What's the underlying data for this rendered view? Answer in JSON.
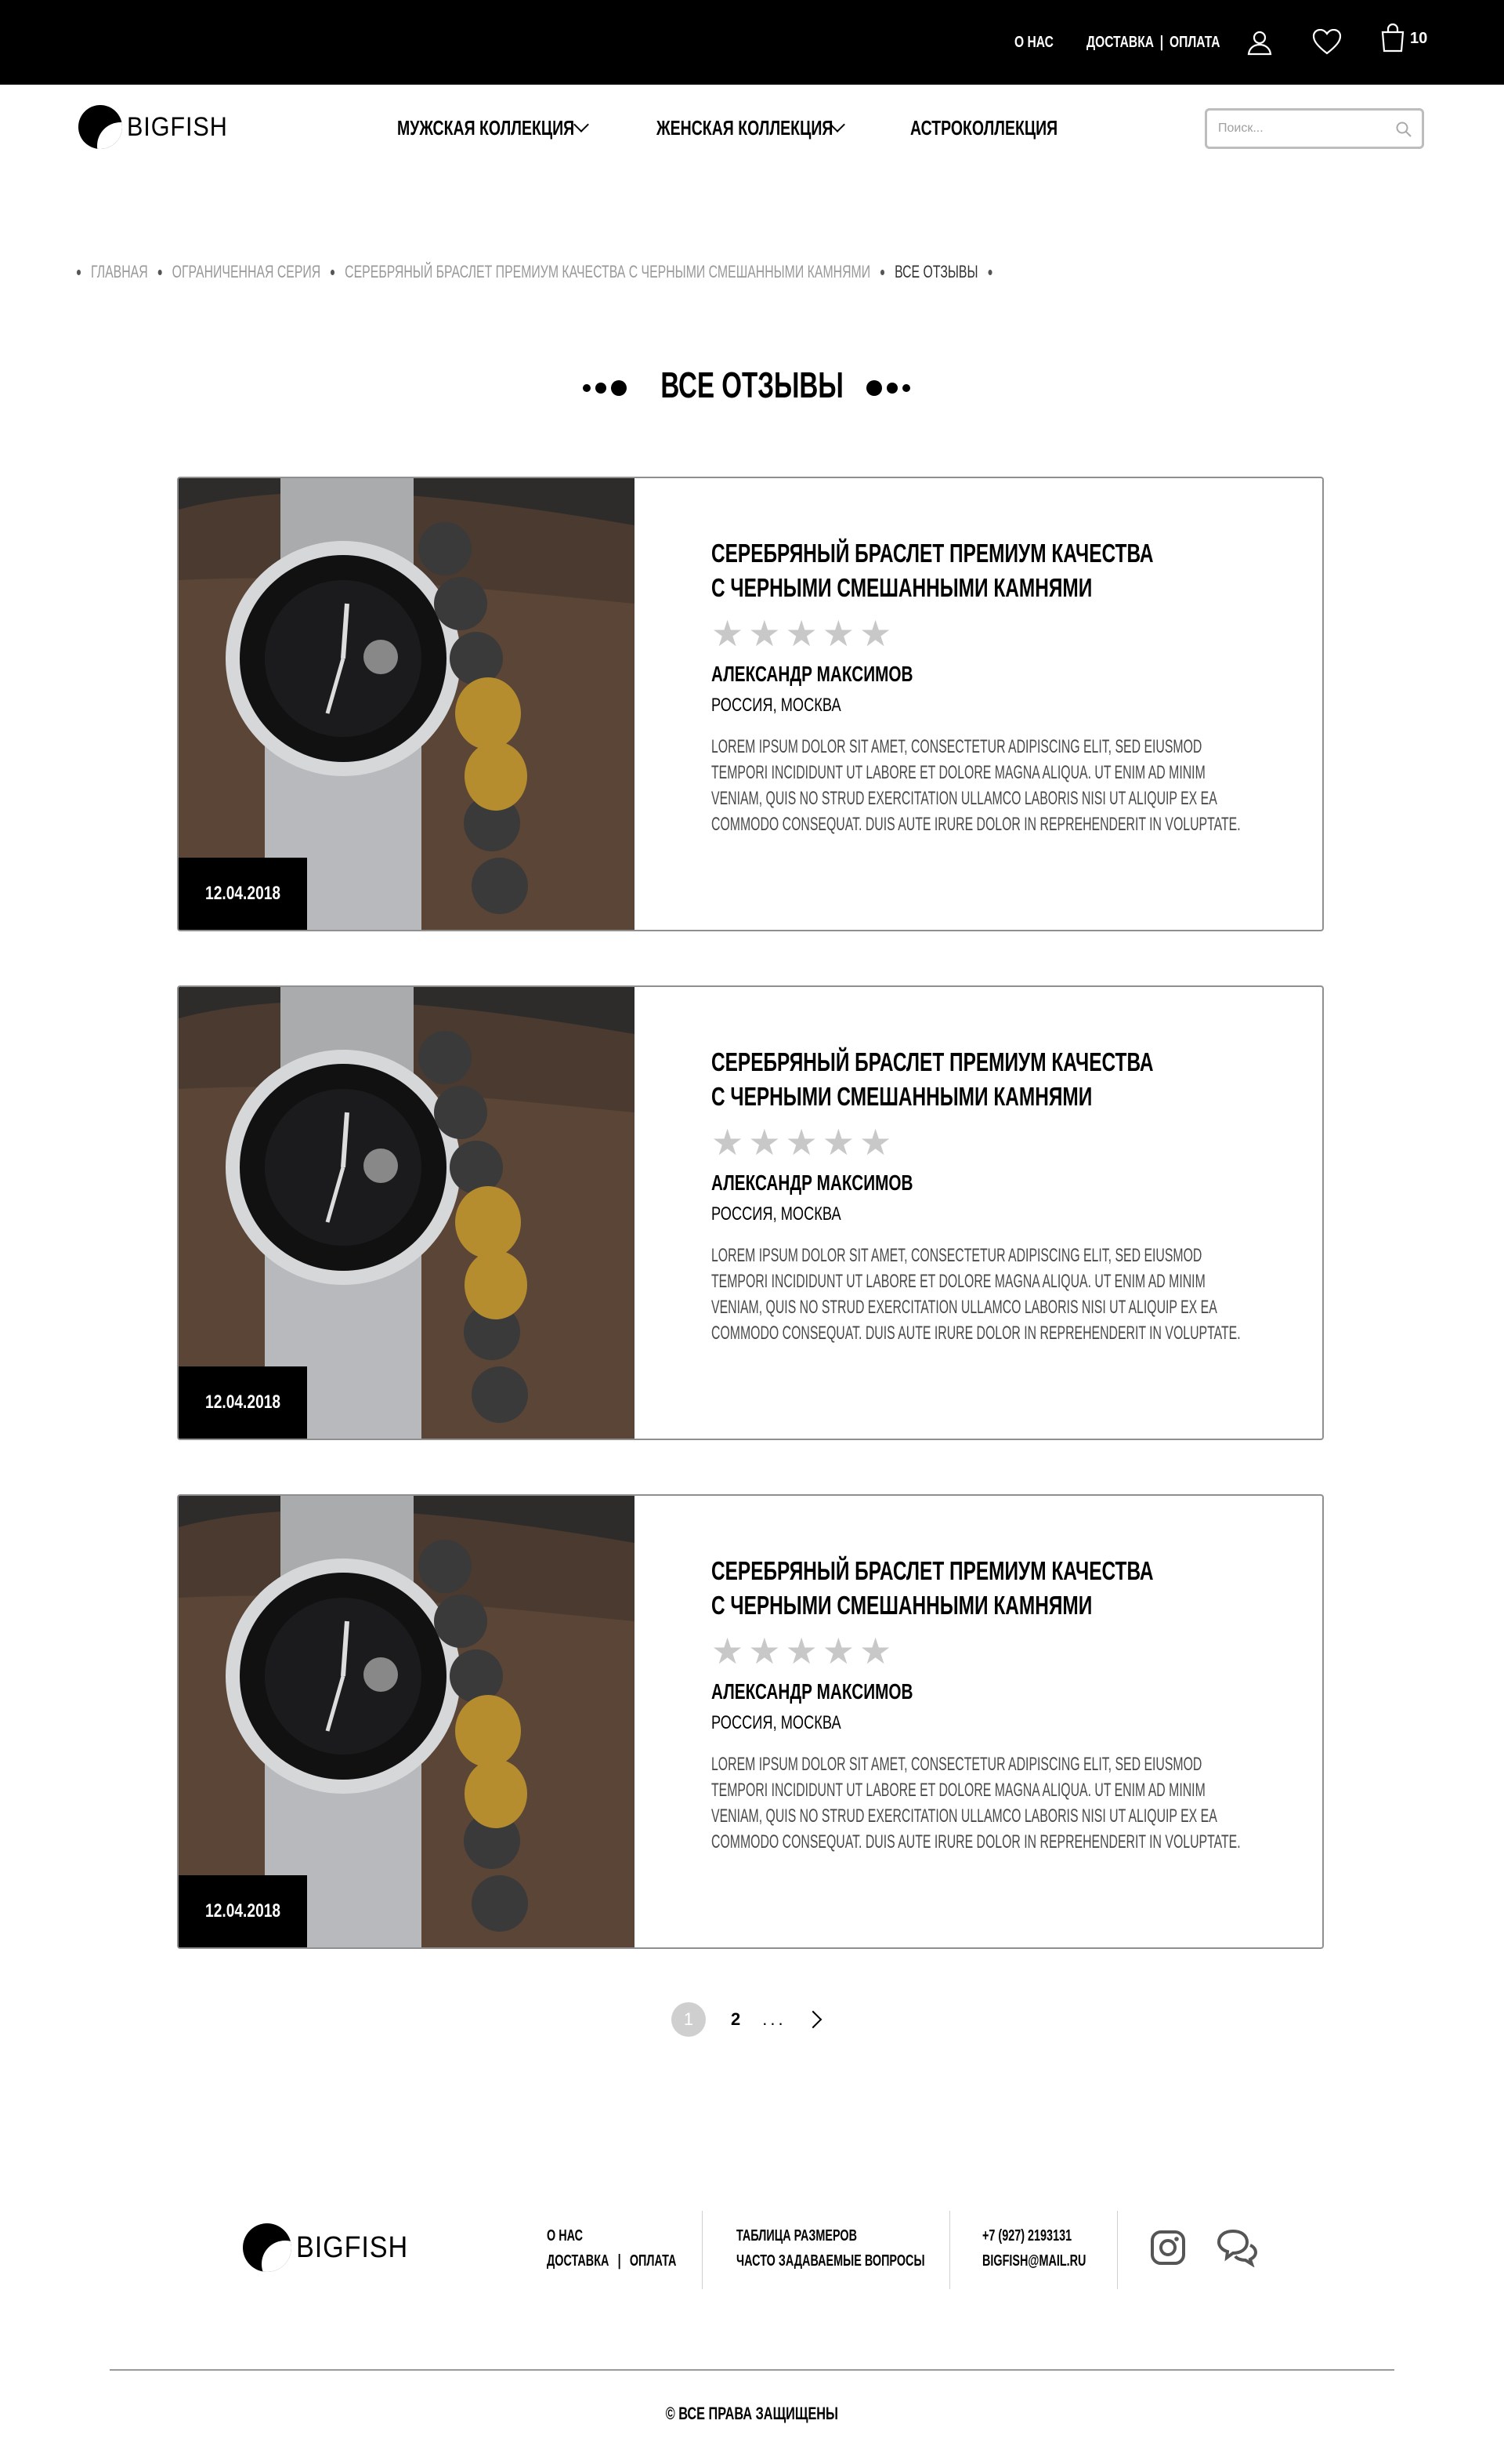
{
  "topbar": {
    "about": "О НАС",
    "delivery": "ДОСТАВКА",
    "payment": "ОПЛАТА",
    "separator": "|",
    "cart_count": "10"
  },
  "header": {
    "logo_text": "BIGFISH",
    "nav": [
      {
        "label": "МУЖСКАЯ КОЛЛЕКЦИЯ"
      },
      {
        "label": "ЖЕНСКАЯ КОЛЛЕКЦИЯ"
      },
      {
        "label": "АСТРОКОЛЛЕКЦИЯ"
      }
    ],
    "search_placeholder": "Поиск..."
  },
  "breadcrumb": [
    "ГЛАВНАЯ",
    "ОГРАНИЧЕННАЯ СЕРИЯ",
    "СЕРЕБРЯНЫЙ БРАСЛЕТ ПРЕМИУМ КАЧЕСТВА С ЧЕРНЫМИ СМЕШАННЫМИ КАМНЯМИ",
    "ВСЕ ОТЗЫВЫ"
  ],
  "page_title": "ВСЕ ОТЗЫВЫ",
  "reviews": [
    {
      "date": "12.04.2018",
      "title_line1": "СЕРЕБРЯНЫЙ БРАСЛЕТ ПРЕМИУМ КАЧЕСТВА",
      "title_line2": "С ЧЕРНЫМИ СМЕШАННЫМИ КАМНЯМИ",
      "rating": 0,
      "author": "АЛЕКСАНДР МАКСИМОВ",
      "location": "РОССИЯ, МОСКВА",
      "text": "Lorem ipsum dolor sit amet, consectetur adipiscing elit, sed eiusmod tempori incididunt ut labore et dolore magna aliqua. Ut enim ad minim veniam, quis no strud exercitation ullamco laboris nisi ut aliquip ex ea commodo consequat. Duis aute irure dolor in reprehenderit in voluptate."
    },
    {
      "date": "12.04.2018",
      "title_line1": "СЕРЕБРЯНЫЙ БРАСЛЕТ ПРЕМИУМ КАЧЕСТВА",
      "title_line2": "С ЧЕРНЫМИ СМЕШАННЫМИ КАМНЯМИ",
      "rating": 0,
      "author": "АЛЕКСАНДР МАКСИМОВ",
      "location": "РОССИЯ, МОСКВА",
      "text": "Lorem ipsum dolor sit amet, consectetur adipiscing elit, sed eiusmod tempori incididunt ut labore et dolore magna aliqua. Ut enim ad minim veniam, quis no strud exercitation ullamco laboris nisi ut aliquip ex ea commodo consequat. Duis aute irure dolor in reprehenderit in voluptate."
    },
    {
      "date": "12.04.2018",
      "title_line1": "СЕРЕБРЯНЫЙ БРАСЛЕТ ПРЕМИУМ КАЧЕСТВА",
      "title_line2": "С ЧЕРНЫМИ СМЕШАННЫМИ КАМНЯМИ",
      "rating": 0,
      "author": "АЛЕКСАНДР МАКСИМОВ",
      "location": "РОССИЯ, МОСКВА",
      "text": "Lorem ipsum dolor sit amet, consectetur adipiscing elit, sed eiusmod tempori incididunt ut labore et dolore magna aliqua. Ut enim ad minim veniam, quis no strud exercitation ullamco laboris nisi ut aliquip ex ea commodo consequat. Duis aute irure dolor in reprehenderit in voluptate."
    }
  ],
  "pagination": {
    "current": "1",
    "next_page": "2",
    "ellipsis": "..."
  },
  "footer": {
    "logo_text": "BIGFISH",
    "about": "О НАС",
    "delivery": "ДОСТАВКА",
    "payment": "ОПЛАТА",
    "separator": "|",
    "size_table": "ТАБЛИЦА РАЗМЕРОВ",
    "faq": "ЧАСТО ЗАДАВАЕМЫЕ ВОПРОСЫ",
    "phone": "+7 (927) 2193131",
    "email": "BIGFISH@MAIL.RU",
    "copyright": "© ВСЕ ПРАВА ЗАЩИЩЕНЫ"
  },
  "icons": [
    "user-icon",
    "heart-icon",
    "bag-icon",
    "search-icon",
    "instagram-icon",
    "chat-icon",
    "star-icon",
    "chevron-down-icon",
    "chevron-right-icon"
  ],
  "colors": {
    "topbar_bg": "#000000",
    "star_inactive": "#c8c8c8",
    "pager_active": "#cfcfcf"
  }
}
